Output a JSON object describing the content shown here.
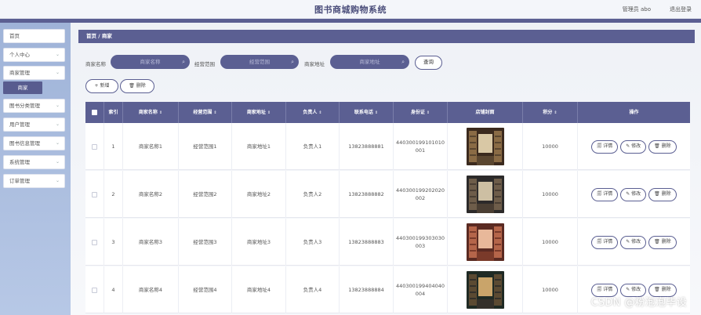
{
  "header": {
    "title": "图书商城购物系统",
    "user": "管理员 abo",
    "logout": "退出登录"
  },
  "sidebar": {
    "items": [
      {
        "label": "首页",
        "chevron": ""
      },
      {
        "label": "个人中心",
        "chevron": "⌄"
      },
      {
        "label": "商家管理",
        "chevron": "⌄"
      },
      {
        "label": "图书分类管理",
        "chevron": "⌄"
      },
      {
        "label": "用户管理",
        "chevron": "⌄"
      },
      {
        "label": "图书信息管理",
        "chevron": "⌄"
      },
      {
        "label": "系统管理",
        "chevron": "⌄"
      },
      {
        "label": "订单管理",
        "chevron": "⌄"
      }
    ],
    "active_sub": "商家"
  },
  "breadcrumb": "首页 / 商家",
  "search": {
    "name_label": "商家名称",
    "name_placeholder": "商家名称",
    "scope_label": "经营范围",
    "scope_placeholder": "经营范围",
    "addr_label": "商家地址",
    "addr_placeholder": "商家地址",
    "query": "查询"
  },
  "actions": {
    "add": "+ 新增",
    "delete": "🗑 删除"
  },
  "table": {
    "headers": {
      "index": "索引",
      "name": "商家名称",
      "scope": "经营范围",
      "address": "商家地址",
      "owner": "负责人",
      "phone": "联系电话",
      "idcard": "身份证",
      "cover": "店铺封面",
      "points": "积分",
      "ops": "操作"
    },
    "sort_glyph": "⇕",
    "rows": [
      {
        "index": "1",
        "name": "商家名称1",
        "scope": "经营范围1",
        "address": "商家地址1",
        "owner": "负责人1",
        "phone": "13823888881",
        "idcard_a": "440300199101010",
        "idcard_b": "001",
        "points": "10000",
        "photo": "bookstore-photo-1"
      },
      {
        "index": "2",
        "name": "商家名称2",
        "scope": "经营范围2",
        "address": "商家地址2",
        "owner": "负责人2",
        "phone": "13823888882",
        "idcard_a": "440300199202020",
        "idcard_b": "002",
        "points": "10000",
        "photo": "bookstore-photo-2"
      },
      {
        "index": "3",
        "name": "商家名称3",
        "scope": "经营范围3",
        "address": "商家地址3",
        "owner": "负责人3",
        "phone": "13823888883",
        "idcard_a": "440300199303030",
        "idcard_b": "003",
        "points": "10000",
        "photo": "bookstore-photo-3"
      },
      {
        "index": "4",
        "name": "商家名称4",
        "scope": "经营范围4",
        "address": "商家地址4",
        "owner": "负责人4",
        "phone": "13823888884",
        "idcard_a": "440300199404040",
        "idcard_b": "004",
        "points": "10000",
        "photo": "bookstore-photo-4"
      }
    ],
    "ops": {
      "detail": "🗐 详情",
      "edit": "✎ 修改",
      "delete": "🗑 删除"
    }
  },
  "watermark": "CSDN @粉泡泡毕设",
  "colors": {
    "primary": "#5b5f92",
    "sidebar": "#a9bbdd",
    "header_bg": "#f4f6fa"
  }
}
